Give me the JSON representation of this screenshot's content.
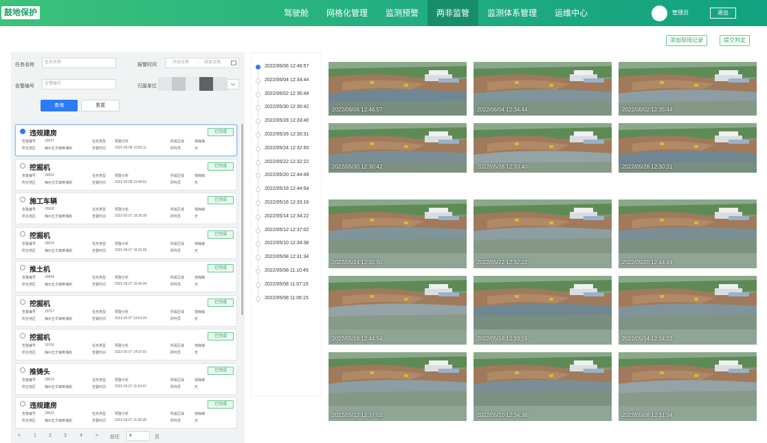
{
  "header": {
    "logo_text": "鼓地保护",
    "nav": [
      "驾驶舱",
      "网格化管理",
      "监测预警",
      "两非监管",
      "监测体系管理",
      "运维中心"
    ],
    "active_nav_index": 3,
    "username": "管理员",
    "logout_label": "退出"
  },
  "actions": {
    "add_record": "添加现场记录",
    "submit_judgement": "提交判定"
  },
  "filters": {
    "task_name_label": "任务名称",
    "task_name_placeholder": "任务名称",
    "alarm_time_label": "报警时间",
    "start_placeholder": "开始日期",
    "range_sep": "-",
    "end_placeholder": "结束日期",
    "alarm_no_label": "告警编号",
    "alarm_no_placeholder": "告警编号",
    "belong_label": "归属单位",
    "query_label": "查询",
    "reset_label": "重置"
  },
  "list": [
    {
      "title": "违规建房",
      "badge": "已完成",
      "alarm_no_label": "告警编号",
      "alarm_no": "29937",
      "place_label": "所在地区",
      "place": "梅州五华镇黄埔街",
      "task_label": "任务类型",
      "task": "预警分析",
      "time_label": "告警时间",
      "time": "2022-05-08 10:55:11",
      "area_label": "所属区域",
      "area": "墙梅镇",
      "handler_label": "研判员",
      "handler": "无"
    },
    {
      "title": "挖掘机",
      "badge": "已完成",
      "alarm_no_label": "告警编号",
      "alarm_no": "29932",
      "place_label": "所在地区",
      "place": "梅州五华镇黄埔街",
      "task_label": "任务类型",
      "task": "预警分析",
      "time_label": "告警时间",
      "time": "2022-05-08 10:48:52",
      "area_label": "所属区域",
      "area": "墙梅镇",
      "handler_label": "研判员",
      "handler": "无"
    },
    {
      "title": "施工车辆",
      "badge": "已完成",
      "alarm_no_label": "告警编号",
      "alarm_no": "29918",
      "place_label": "所在地区",
      "place": "梅州五华镇黄埔街",
      "task_label": "任务类型",
      "task": "预警分析",
      "time_label": "告警时间",
      "time": "2022-05-07 18:36:28",
      "area_label": "所属区域",
      "area": "墙梅镇",
      "handler_label": "研判员",
      "handler": "无"
    },
    {
      "title": "挖掘机",
      "badge": "已完成",
      "alarm_no_label": "告警编号",
      "alarm_no": "29914",
      "place_label": "所在地区",
      "place": "梅州五华镇黄埔街",
      "task_label": "任务类型",
      "task": "预警分析",
      "time_label": "告警时间",
      "time": "2022-05-07 18:32:06",
      "area_label": "所属区域",
      "area": "墙梅镇",
      "handler_label": "研判员",
      "handler": "无"
    },
    {
      "title": "推土机",
      "badge": "已完成",
      "alarm_no_label": "告警编号",
      "alarm_no": "29844",
      "place_label": "所在地区",
      "place": "梅州五华镇黄埔街",
      "task_label": "任务类型",
      "task": "预警分析",
      "time_label": "告警时间",
      "time": "2022-05-07 15:46:04",
      "area_label": "所属区域",
      "area": "墙梅镇",
      "handler_label": "研判员",
      "handler": "无"
    },
    {
      "title": "挖掘机",
      "badge": "已完成",
      "alarm_no_label": "告警编号",
      "alarm_no": "29707",
      "place_label": "所在地区",
      "place": "梅州五华镇黄埔街",
      "task_label": "任务类型",
      "task": "预警分析",
      "time_label": "告警时间",
      "time": "2022-05-07 14:43:24",
      "area_label": "所属区域",
      "area": "墙梅镇",
      "handler_label": "研判员",
      "handler": "无"
    },
    {
      "title": "挖掘机",
      "badge": "已完成",
      "alarm_no_label": "告警编号",
      "alarm_no": "29705",
      "place_label": "所在地区",
      "place": "梅州五华镇黄埔街",
      "task_label": "任务类型",
      "task": "预警分析",
      "time_label": "告警时间",
      "time": "2022-05-07 14:37:01",
      "area_label": "所属区域",
      "area": "墙梅镇",
      "handler_label": "研判员",
      "handler": "无"
    },
    {
      "title": "推铸头",
      "badge": "已完成",
      "alarm_no_label": "告警编号",
      "alarm_no": "29614",
      "place_label": "所在地区",
      "place": "梅州五华镇黄埔街",
      "task_label": "任务类型",
      "task": "预警分析",
      "time_label": "告警时间",
      "time": "2022-05-07 11:43:47",
      "area_label": "所属区域",
      "area": "墙梅镇",
      "handler_label": "研判员",
      "handler": "无"
    },
    {
      "title": "违规建房",
      "badge": "已完成",
      "alarm_no_label": "告警编号",
      "alarm_no": "29622",
      "place_label": "所在地区",
      "place": "梅州五华镇黄埔街",
      "task_label": "任务类型",
      "task": "预警分析",
      "time_label": "告警时间",
      "time": "2022-05-07 11:08:38",
      "area_label": "所属区域",
      "area": "墙梅镇",
      "handler_label": "研判员",
      "handler": "无"
    }
  ],
  "pagination": {
    "prev": "<",
    "pages": [
      "1",
      "2",
      "3",
      "4"
    ],
    "current_page": "4",
    "next": ">",
    "goto_label": "前往",
    "goto_value": "4",
    "page_unit": "页"
  },
  "timeline": [
    "2022/06/06 12:46:57",
    "2022/06/04 12:34:44",
    "2022/06/02 12:35:44",
    "2022/05/30 12:30:42",
    "2022/05/28 12:33:40",
    "2022/05/26 12:30:31",
    "2022/05/24 12:32:50",
    "2022/05/22 12:32:22",
    "2022/05/20 12:44:49",
    "2022/05/18 12:44:54",
    "2022/05/16 12:33:16",
    "2022/05/14 12:34:22",
    "2022/05/12 12:37:02",
    "2022/05/10 12:34:38",
    "2022/05/08 12:31:34",
    "2022/05/08 11:10:45",
    "2022/05/08 11:07:15",
    "2022/05/08 11:06:15"
  ],
  "timeline_active_index": 0,
  "photos": [
    "2022/06/06 12:46:57",
    "2022/06/04 12:34:44",
    "2022/06/02 12:35:44",
    "2022/05/30 12:30:42",
    "2022/05/28 12:33:40",
    "2022/05/26 12:30:31",
    "2022/05/24 12:32:50",
    "2022/05/22 12:32:22",
    "2022/05/20 12:44:49",
    "2022/05/18 12:44:54",
    "2022/05/16 12:33:16",
    "2022/05/14 12:34:22",
    "2022/05/12 12:37:02",
    "2022/05/10 12:34:38",
    "2022/05/08 12:31:34"
  ]
}
